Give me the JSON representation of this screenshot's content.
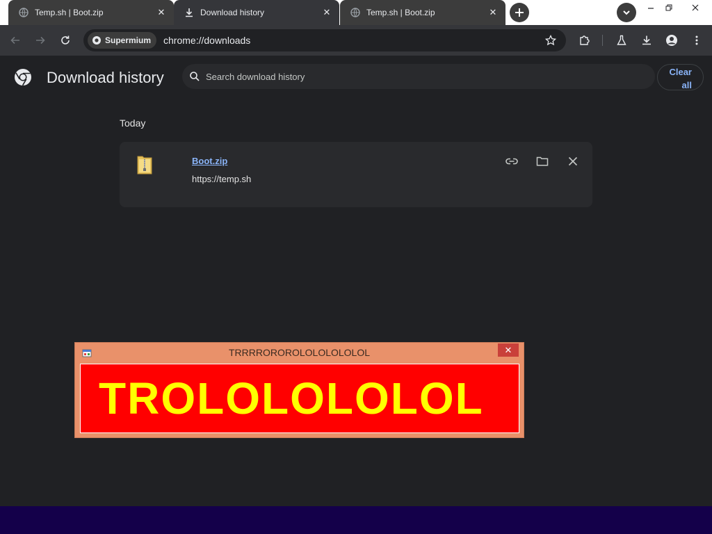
{
  "tabs": [
    {
      "title": "Temp.sh | Boot.zip",
      "favicon": "globe-icon",
      "active": false
    },
    {
      "title": "Download history",
      "favicon": "download-icon",
      "active": true
    },
    {
      "title": "Temp.sh | Boot.zip",
      "favicon": "globe-icon",
      "active": false
    }
  ],
  "toolbar": {
    "profile_chip": "Supermium",
    "url": "chrome://downloads"
  },
  "page": {
    "title": "Download history",
    "search_placeholder": "Search download history",
    "clear_all_line1": "Clear",
    "clear_all_line2": "all",
    "section": "Today"
  },
  "download": {
    "file_name": "Boot.zip",
    "source_url": "https://temp.sh",
    "icon": "zip-folder-icon"
  },
  "popup": {
    "title": "TRRRROROROLOLOLOLOLOL",
    "message": "TROLOLOLOLOL",
    "close_label": "✕"
  },
  "colors": {
    "accent": "#8ab4f8",
    "background": "#202124",
    "popup_frame": "#e9916a",
    "popup_body": "#ff0000",
    "popup_text": "#ffff00",
    "taskbar": "#14004a"
  }
}
